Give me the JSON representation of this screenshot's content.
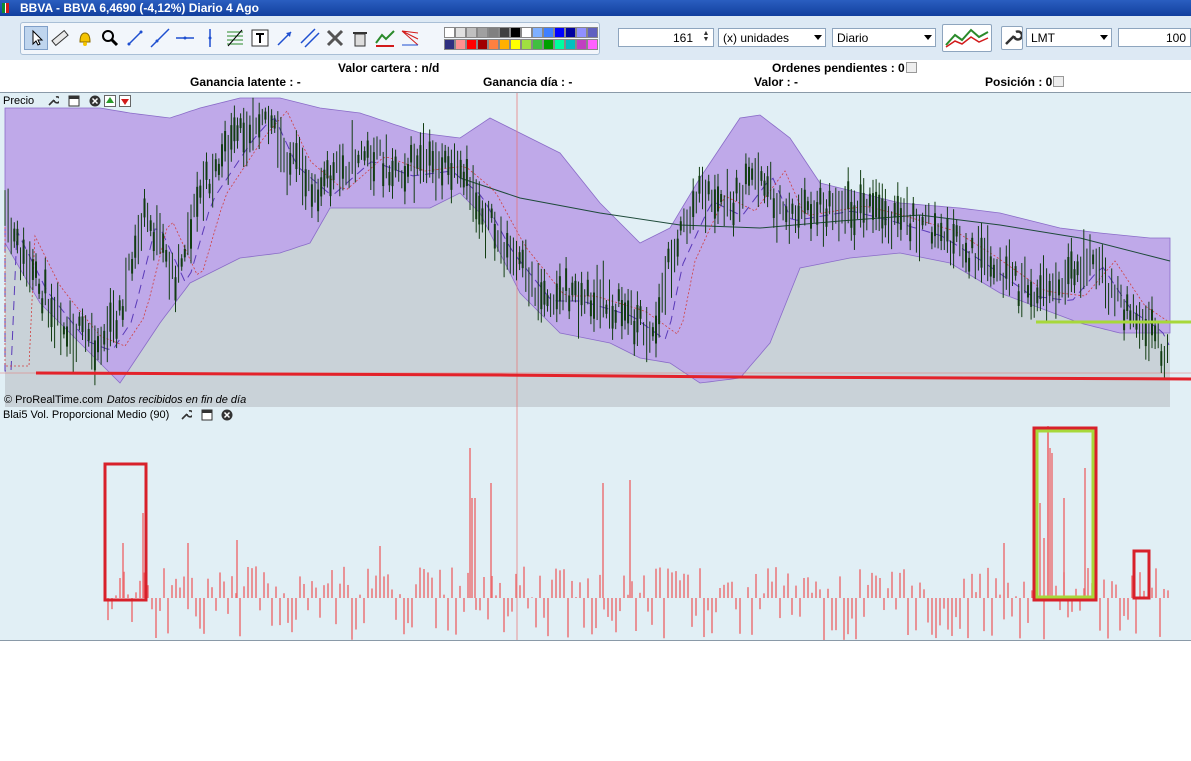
{
  "window": {
    "title": "BBVA - BBVA    6,4690 (-4,12%)   Diario  4 Ago",
    "flag_colors": [
      "#0c8a2e",
      "#ffffff",
      "#d21a1a"
    ]
  },
  "toolbar": {
    "tools": [
      {
        "name": "pointer-icon"
      },
      {
        "name": "ruler-icon"
      },
      {
        "name": "alarm-bell-icon"
      },
      {
        "name": "zoom-icon"
      },
      {
        "name": "trend-line-icon"
      },
      {
        "name": "ray-line-icon"
      },
      {
        "name": "horizontal-line-icon"
      },
      {
        "name": "vertical-line-icon"
      },
      {
        "name": "fibonacci-icon"
      },
      {
        "name": "text-tool-icon"
      },
      {
        "name": "arrow-line-icon"
      },
      {
        "name": "parallel-channel-icon"
      },
      {
        "name": "drawing-tools-icon"
      },
      {
        "name": "delete-drawings-icon"
      },
      {
        "name": "object-style-icon"
      },
      {
        "name": "fan-lines-icon"
      }
    ],
    "quantity": "161",
    "units_select": "(x) unidades",
    "timeframe_select": "Diario",
    "order_type_select": "LMT",
    "price_limit": "100",
    "palette_colors": [
      "#ffffff",
      "#e0e0e0",
      "#c0c0c0",
      "#a0a0a0",
      "#808080",
      "#404040",
      "#000000",
      "#ffffff",
      "#7fb0ff",
      "#3f7fff",
      "#0000ff",
      "#0000a0",
      "#9090ff",
      "#6060c0",
      "#303080",
      "#ff9090",
      "#ff0000",
      "#a00000",
      "#ff8040",
      "#ffb000",
      "#ffff00",
      "#a0e040",
      "#40c040",
      "#00a000",
      "#00ffa0",
      "#00c0c0",
      "#c040c0",
      "#ff60ff"
    ]
  },
  "info": {
    "valor_cartera": "Valor cartera : n/d",
    "ordenes_pendientes": "Ordenes pendientes : 0",
    "ganancia_latente": "Ganancia latente : -",
    "ganancia_dia": "Ganancia día : -",
    "valor": "Valor : -",
    "posicion": "Posición : 0"
  },
  "price_panel": {
    "label": "Precio",
    "watermark": "© ProRealTime.com",
    "watermark_note": "Datos recibidos en fin de día"
  },
  "volume_panel": {
    "label": "Blai5 Vol. Proporcional Medio (90)"
  },
  "colors": {
    "panel_bg": "#e1eff5",
    "band_fill": "#b99ce6",
    "area_fill": "#c9d2d8",
    "candle": "#123d12",
    "support_red": "#e3222a",
    "support_green": "#a7d83a",
    "volume_bar": "#ec6a6e",
    "highlight_red": "#d8202a",
    "highlight_green": "#a7d83a"
  }
}
